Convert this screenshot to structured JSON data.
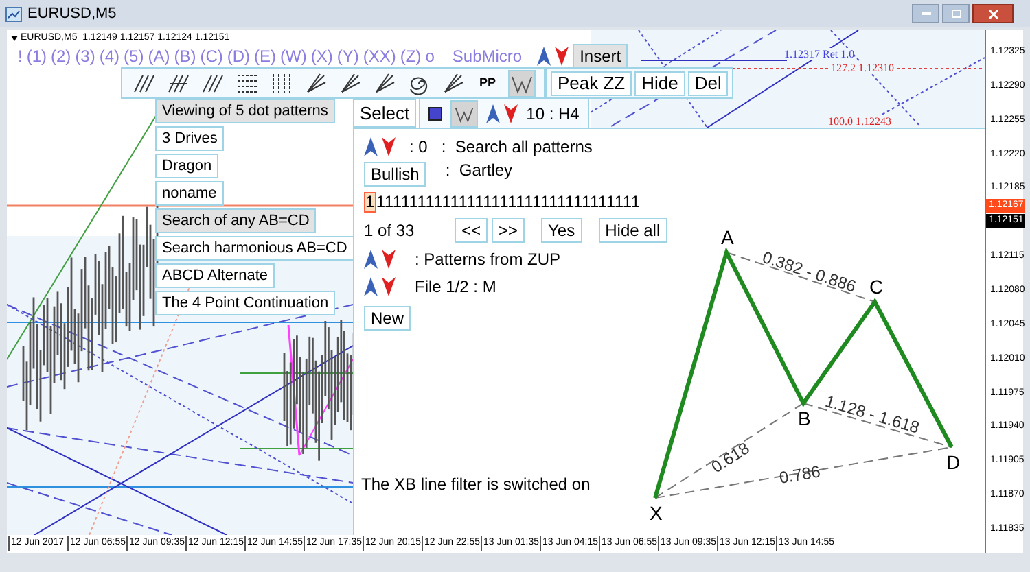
{
  "window": {
    "title": "EURUSD,M5"
  },
  "chart": {
    "header": "EURUSD,M5  1.12149 1.12157 1.12124 1.12151",
    "price_labels": [
      "1.12325",
      "1.12290",
      "1.12255",
      "1.12220",
      "1.12185",
      "1.12115",
      "1.12080",
      "1.12045",
      "1.12010",
      "1.11975",
      "1.11940",
      "1.11905",
      "1.11870",
      "1.11835"
    ],
    "price_badges": [
      {
        "text": "1.12167",
        "color": "#ff4a1c"
      },
      {
        "text": "1.12151",
        "color": "#000000"
      }
    ],
    "time_labels": [
      "12 Jun 2017",
      "12 Jun 06:55",
      "12 Jun 09:35",
      "12 Jun 12:15",
      "12 Jun 14:55",
      "12 Jun 17:35",
      "12 Jun 20:15",
      "12 Jun 22:55",
      "13 Jun 01:35",
      "13 Jun 04:15",
      "13 Jun 06:55",
      "13 Jun 09:35",
      "13 Jun 12:15",
      "13 Jun 14:55"
    ],
    "level_labels": [
      {
        "text": "1.12317 Ret 1.0",
        "color": "#4040e0"
      },
      {
        "text": "127.2 1.12310",
        "color": "#e02020"
      },
      {
        "text": "100.0 1.12243",
        "color": "#e02020"
      }
    ]
  },
  "menu": {
    "items": [
      "!",
      "(1)",
      "(2)",
      "(3)",
      "(4)",
      "(5)",
      "(A)",
      "(B)",
      "(C)",
      "(D)",
      "(E)",
      "(W)",
      "(X)",
      "(Y)",
      "(XX)",
      "(Z)",
      "o",
      "SubMicro"
    ],
    "insert": "Insert"
  },
  "toolbar": {
    "tools": [
      {
        "kind": "hatch",
        "selected": false
      },
      {
        "kind": "hatch-cross",
        "selected": false
      },
      {
        "kind": "hatch",
        "selected": false
      },
      {
        "kind": "hgrid",
        "selected": false
      },
      {
        "kind": "vgrid",
        "selected": false
      },
      {
        "kind": "fan",
        "selected": false
      },
      {
        "kind": "fan",
        "selected": false
      },
      {
        "kind": "fan",
        "selected": false
      },
      {
        "kind": "spiral",
        "selected": false
      },
      {
        "kind": "fan",
        "selected": false
      },
      {
        "kind": "text",
        "label": "PP",
        "selected": false
      },
      {
        "kind": "pattern",
        "selected": true
      }
    ],
    "buttons": [
      "Peak ZZ",
      "Hide",
      "Del"
    ]
  },
  "patterns": [
    {
      "label": "Viewing of 5 dot patterns",
      "selected": true
    },
    {
      "label": "3 Drives",
      "selected": false
    },
    {
      "label": "Dragon",
      "selected": false
    },
    {
      "label": "noname",
      "selected": false
    },
    {
      "label": "Search of any AB=CD",
      "selected": true
    },
    {
      "label": "Search harmonious AB=CD",
      "selected": false
    },
    {
      "label": "ABCD Alternate",
      "selected": false
    },
    {
      "label": "The 4 Point Continuation",
      "selected": false
    }
  ],
  "selector": {
    "select": "Select",
    "pattern_selected": true,
    "timeframe": "10 : H4"
  },
  "panel": {
    "count": ": 0",
    "search": ":  Search all patterns",
    "direction": "Bullish",
    "pattern_name": ":  Gartley",
    "sequence": {
      "current": "1",
      "rest": "11111111111111111111111111111111"
    },
    "position": "1 of 33",
    "nav_buttons": [
      "<<",
      ">>",
      "Yes",
      "Hide all"
    ],
    "source": ": Patterns from ZUP",
    "file": "File 1/2 : M",
    "new": "New",
    "filter_note": "The XB line filter is switched on",
    "points": [
      "X",
      "A",
      "B",
      "C",
      "D"
    ],
    "ratios": [
      "0.382 - 0.886",
      "0.618",
      "1.128 - 1.618",
      "0.786"
    ]
  }
}
